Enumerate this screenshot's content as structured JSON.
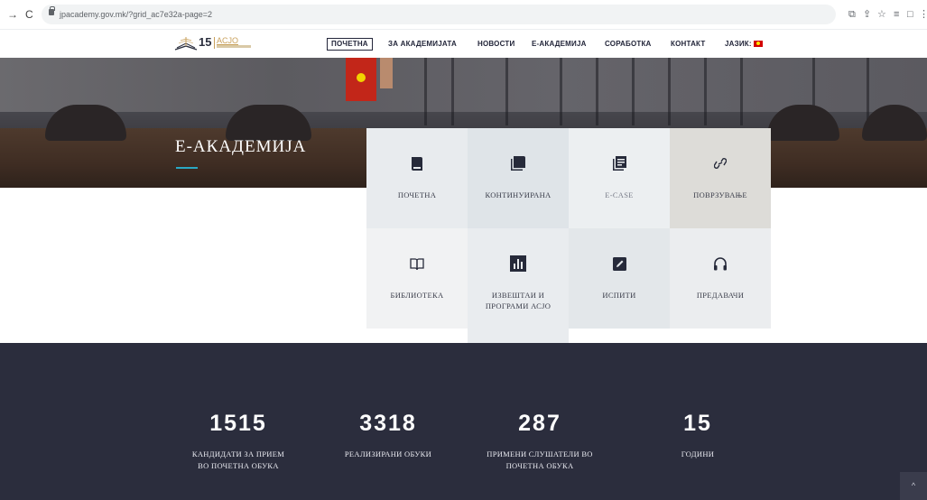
{
  "browser": {
    "url": "jpacademy.gov.mk/?grid_ac7e32a-page=2",
    "back_glyph": "→",
    "reload_glyph": "C",
    "toolbar_icons": [
      "⧉",
      "⇪",
      "☆",
      "≡",
      "□",
      "⋮"
    ]
  },
  "logo": {
    "number": "15",
    "name": "ACJO"
  },
  "menu": {
    "items": [
      {
        "label": "ПОЧЕТНА",
        "active": true
      },
      {
        "label": "ЗА АКАДЕМИЈАТА",
        "active": false
      },
      {
        "label": "НОВОСТИ",
        "active": false
      },
      {
        "label": "Е-АКАДЕМИЈА",
        "active": false
      },
      {
        "label": "СОРАБОТКА",
        "active": false
      },
      {
        "label": "КОНТАКТ",
        "active": false
      }
    ],
    "language_label": "ЈАЗИК:"
  },
  "hero": {
    "title": "Е-АКАДЕМИЈА"
  },
  "tiles": [
    {
      "label": "ПОЧЕТНА",
      "icon": "book-icon",
      "bg": "#e8ebee"
    },
    {
      "label": "КОНТИНУИРАНА",
      "icon": "books-icon",
      "bg": "#dfe4e8"
    },
    {
      "label": "E-CASE",
      "icon": "document-icon",
      "bg": "#eceff1"
    },
    {
      "label": "ПОВРЗУВАЊЕ",
      "icon": "link-icon",
      "bg": "#dddcd8"
    },
    {
      "label": "БИБЛИОТЕКА",
      "icon": "open-book-icon",
      "bg": "#f1f2f3"
    },
    {
      "label": "ИЗВЕШТАИ И ПРОГРАМИ АСЈО",
      "icon": "bar-chart-icon",
      "bg": "#e9ecef"
    },
    {
      "label": "ИСПИТИ",
      "icon": "edit-icon",
      "bg": "#e3e7ea"
    },
    {
      "label": "ПРЕДАВАЧИ",
      "icon": "headphones-icon",
      "bg": "#ebedef"
    }
  ],
  "stats": [
    {
      "number": "1515",
      "label": "КАНДИДАТИ ЗА ПРИЕМ ВО ПОЧЕТНА ОБУКА"
    },
    {
      "number": "3318",
      "label": "РЕАЛИЗИРАНИ ОБУКИ"
    },
    {
      "number": "287",
      "label": "ПРИМЕНИ СЛУШАТЕЛИ ВО ПОЧЕТНА ОБУКА"
    },
    {
      "number": "15",
      "label": "ГОДИНИ"
    }
  ],
  "scroll_top_glyph": "^",
  "colors": {
    "accent": "#2aa8c4",
    "dark_band": "#2b2d3d",
    "brand_gold": "#c9a15c",
    "text_dark": "#23263a"
  }
}
